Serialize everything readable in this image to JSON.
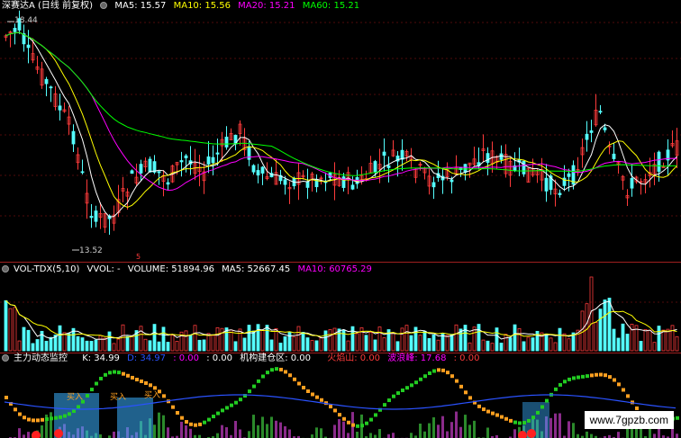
{
  "price_header": {
    "stock": "深赛达A (日线 前复权)",
    "ma5": "MA5: 15.57",
    "ma10": "MA10: 15.56",
    "ma20": "MA20: 15.21",
    "ma60": "MA60: 15.21"
  },
  "price_labels": {
    "high": "18.44",
    "low": "13.52",
    "mark": "5"
  },
  "volume_header": {
    "name": "VOL-TDX(5,10)",
    "vvol": "VVOL: -",
    "volume": "VOLUME: 51894.96",
    "ma5": "MA5: 52667.45",
    "ma10": "MA10: 60765.29"
  },
  "indicator_header": {
    "name": "主力动态监控",
    "k": "K: 34.99",
    "d": "D: 34.97",
    "v1": ": 0.00",
    "v2": ": 0.00",
    "jigou": "机构建仓区: 0.00",
    "huoshan": "火焰山: 0.00",
    "bolang": "波浪峰: 17.68",
    "v3": ": 0.00"
  },
  "indicator_labels": {
    "buy": "买入"
  },
  "watermark": "www.7gpzb.com",
  "colors": {
    "up": "#ff3b3b",
    "down": "#54ffff",
    "ma5": "#ffffff",
    "ma10": "#ffff00",
    "ma20": "#ff00ff",
    "ma60": "#00ff00",
    "kline": "#2a52ff",
    "grid": "#a01515"
  }
}
